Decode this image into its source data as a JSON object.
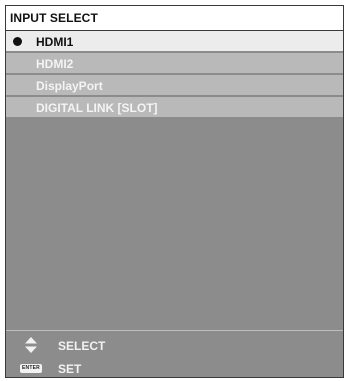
{
  "title": "INPUT SELECT",
  "inputs": [
    {
      "label": "HDMI1",
      "selected": true
    },
    {
      "label": "HDMI2",
      "selected": false
    },
    {
      "label": "DisplayPort",
      "selected": false
    },
    {
      "label": "DIGITAL LINK [SLOT]",
      "selected": false
    }
  ],
  "guide": {
    "select_icon": "up-down-arrow-icon",
    "select_label": "SELECT",
    "set_icon_text": "ENTER",
    "set_label": "SET"
  },
  "colors": {
    "panel_bg": "#8c8c8c",
    "selected_item_bg": "#ececec",
    "item_bg": "#b9b9b9",
    "title_bg": "#ffffff"
  }
}
